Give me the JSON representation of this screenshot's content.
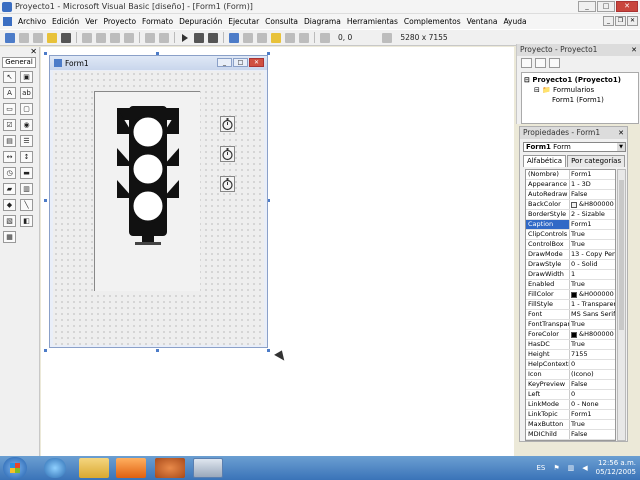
{
  "window": {
    "title": "Proyecto1 - Microsoft Visual Basic [diseño] - [Form1 (Form)]"
  },
  "menu": [
    "Archivo",
    "Edición",
    "Ver",
    "Proyecto",
    "Formato",
    "Depuración",
    "Ejecutar",
    "Consulta",
    "Diagrama",
    "Herramientas",
    "Complementos",
    "Ventana",
    "Ayuda"
  ],
  "toolbar": {
    "position": "0, 0",
    "size": "5280 x 7155"
  },
  "toolbox": {
    "tab": "General"
  },
  "form": {
    "title": "Form1"
  },
  "project": {
    "title": "Proyecto - Proyecto1",
    "root": "Proyecto1 (Proyecto1)",
    "folder": "Formularios",
    "item": "Form1 (Form1)"
  },
  "properties": {
    "title": "Propiedades - Form1",
    "object_name": "Form1",
    "object_type": "Form",
    "tab_alpha": "Alfabética",
    "tab_cat": "Por categorías",
    "rows": [
      {
        "name": "(Nombre)",
        "value": "Form1"
      },
      {
        "name": "Appearance",
        "value": "1 - 3D"
      },
      {
        "name": "AutoRedraw",
        "value": "False"
      },
      {
        "name": "BackColor",
        "value": "&H800000",
        "swatch": "#f0f0f0"
      },
      {
        "name": "BorderStyle",
        "value": "2 - Sizable"
      },
      {
        "name": "Caption",
        "value": "Form1",
        "selected": true
      },
      {
        "name": "ClipControls",
        "value": "True"
      },
      {
        "name": "ControlBox",
        "value": "True"
      },
      {
        "name": "DrawMode",
        "value": "13 - Copy Pen"
      },
      {
        "name": "DrawStyle",
        "value": "0 - Solid"
      },
      {
        "name": "DrawWidth",
        "value": "1"
      },
      {
        "name": "Enabled",
        "value": "True"
      },
      {
        "name": "FillColor",
        "value": "&H000000",
        "swatch": "#000000"
      },
      {
        "name": "FillStyle",
        "value": "1 - Transparent"
      },
      {
        "name": "Font",
        "value": "MS Sans Serif"
      },
      {
        "name": "FontTransparent",
        "value": "True"
      },
      {
        "name": "ForeColor",
        "value": "&H800000",
        "swatch": "#000000"
      },
      {
        "name": "HasDC",
        "value": "True"
      },
      {
        "name": "Height",
        "value": "7155"
      },
      {
        "name": "HelpContextID",
        "value": "0"
      },
      {
        "name": "Icon",
        "value": "(Icono)"
      },
      {
        "name": "KeyPreview",
        "value": "False"
      },
      {
        "name": "Left",
        "value": "0"
      },
      {
        "name": "LinkMode",
        "value": "0 - None"
      },
      {
        "name": "LinkTopic",
        "value": "Form1"
      },
      {
        "name": "MaxButton",
        "value": "True"
      },
      {
        "name": "MDIChild",
        "value": "False"
      }
    ]
  },
  "taskbar": {
    "lang": "ES",
    "time": "12:56 a.m.",
    "date": "05/12/2005"
  }
}
